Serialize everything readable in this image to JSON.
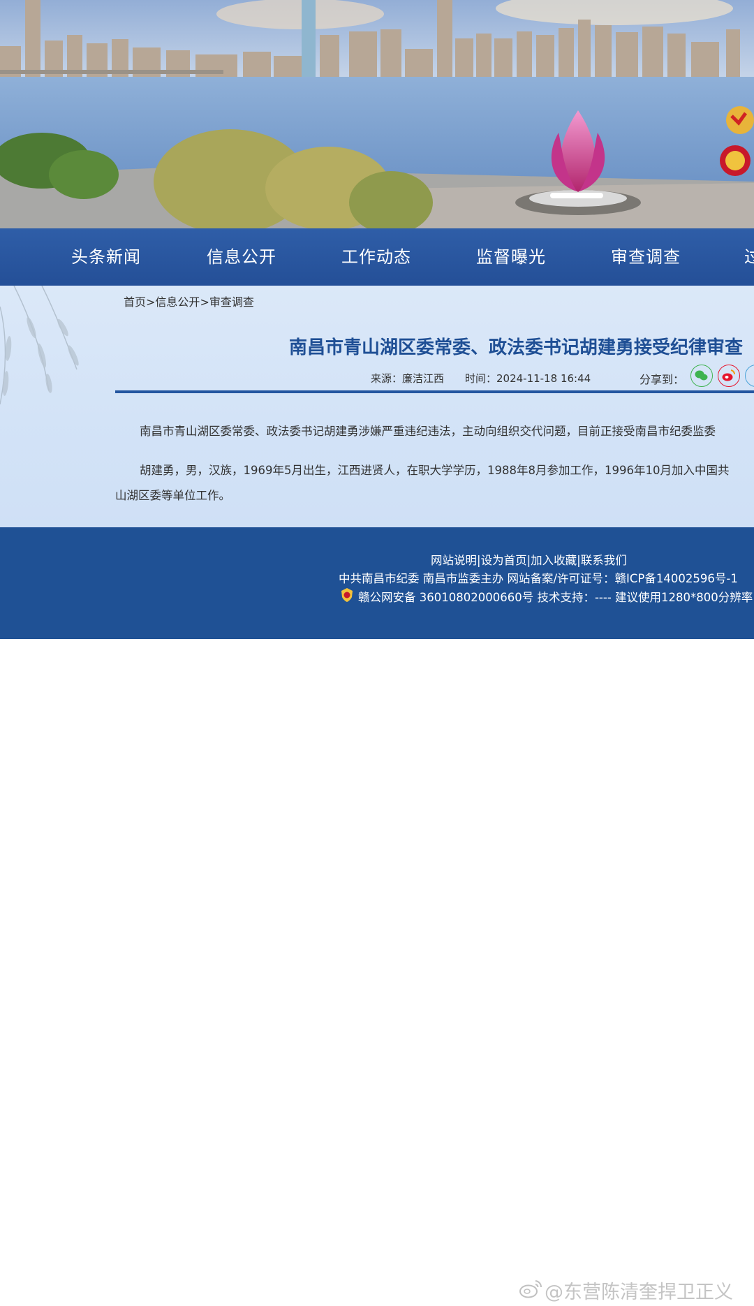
{
  "nav": {
    "items": [
      {
        "label": "头条新闻"
      },
      {
        "label": "信息公开"
      },
      {
        "label": "工作动态"
      },
      {
        "label": "监督曝光"
      },
      {
        "label": "审查调查"
      },
      {
        "label": "过"
      }
    ]
  },
  "breadcrumb": {
    "home": "首页",
    "section": "信息公开",
    "current": "审查调查",
    "separator": ">"
  },
  "article": {
    "title": "南昌市青山湖区委常委、政法委书记胡建勇接受纪律审查",
    "source": "来源：廉洁江西",
    "time": "时间：2024-11-18 16:44",
    "share_label": "分享到：",
    "paragraph1": "南昌市青山湖区委常委、政法委书记胡建勇涉嫌严重违纪违法，主动向组织交代问题，目前正接受南昌市纪委监委",
    "paragraph2_line1": "胡建勇，男，汉族，1969年5月出生，江西进贤人，在职大学学历，1988年8月参加工作，1996年10月加入中国共",
    "paragraph2_line2": "山湖区委等单位工作。"
  },
  "footer": {
    "link1": "网站说明",
    "link2": "设为首页",
    "link3": "加入收藏",
    "link4": "联系我们",
    "divider": "|",
    "line1": "中共南昌市纪委 南昌市监委主办 网站备案/许可证号：赣ICP备14002596号-1",
    "line2": "赣公网安备 36010802000660号 技术支持：---- 建议使用1280*800分辨率"
  },
  "watermark": {
    "text": "@东营陈清奎捍卫正义"
  },
  "colors": {
    "nav_bg": "#2a579f",
    "title": "#1f4f95",
    "footer_bg": "#1f5195",
    "content_bg": "#d6e5f8",
    "wechat": "#3fb34f",
    "weibo": "#e6162d",
    "third_share": "#4aa3d8"
  },
  "icons": {
    "share": [
      "wechat-icon",
      "weibo-icon",
      "share-more-icon"
    ],
    "footer": "police-badge-icon",
    "watermark": "weibo-logo-icon"
  }
}
